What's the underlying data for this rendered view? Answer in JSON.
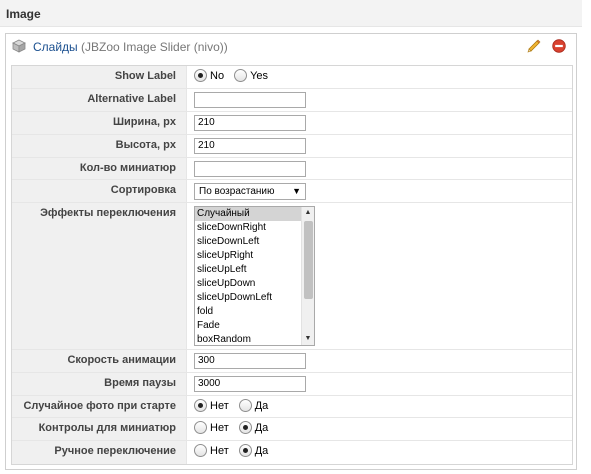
{
  "section": {
    "title": "Image"
  },
  "panel": {
    "name": "Слайды",
    "type": "(JBZoo Image Slider (nivo))",
    "icons": {
      "element": "cube-icon",
      "edit": "pencil-icon",
      "delete": "delete-icon"
    },
    "colors": {
      "name": "#1a4f8f",
      "delete": "#d9412f",
      "pencil": "#e8a317"
    }
  },
  "fields": {
    "show_label": {
      "label": "Show Label",
      "options": [
        "No",
        "Yes"
      ],
      "selected": "No"
    },
    "alt_label": {
      "label": "Alternative Label",
      "value": ""
    },
    "width": {
      "label": "Ширина, px",
      "value": "210"
    },
    "height": {
      "label": "Высота, px",
      "value": "210"
    },
    "thumb_count": {
      "label": "Кол-во миниатюр",
      "value": ""
    },
    "sort": {
      "label": "Сортировка",
      "value": "По возрастанию"
    },
    "effects": {
      "label": "Эффекты переключения",
      "options": [
        "Случайный",
        "sliceDownRight",
        "sliceDownLeft",
        "sliceUpRight",
        "sliceUpLeft",
        "sliceUpDown",
        "sliceUpDownLeft",
        "fold",
        "Fade",
        "boxRandom"
      ],
      "selected": "Случайный"
    },
    "anim_speed": {
      "label": "Скорость анимации",
      "value": "300"
    },
    "pause_time": {
      "label": "Время паузы",
      "value": "3000"
    },
    "random_start": {
      "label": "Случайное фото при старте",
      "options": [
        "Нет",
        "Да"
      ],
      "selected": "Нет"
    },
    "thumb_controls": {
      "label": "Контролы для миниатюр",
      "options": [
        "Нет",
        "Да"
      ],
      "selected": "Да"
    },
    "manual": {
      "label": "Ручное переключение",
      "options": [
        "Нет",
        "Да"
      ],
      "selected": "Да"
    }
  }
}
